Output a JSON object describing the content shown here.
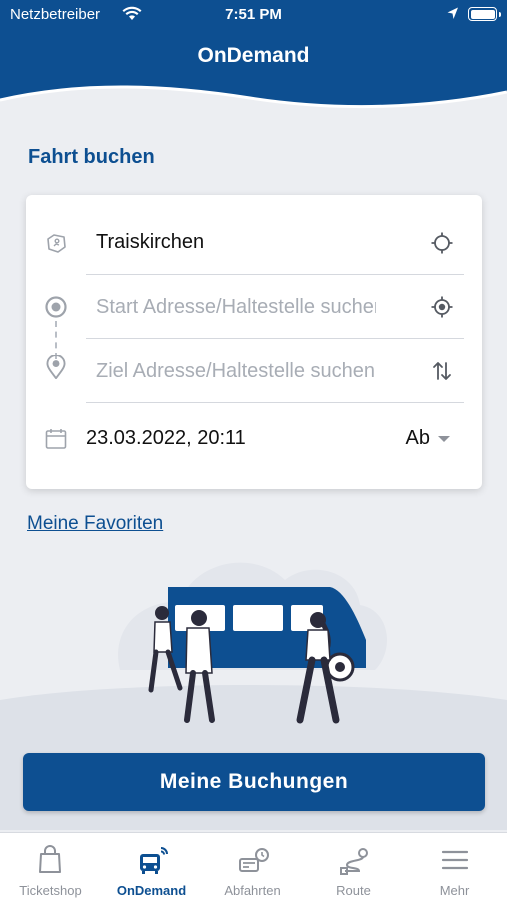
{
  "status_bar": {
    "carrier": "Netzbetreiber",
    "time": "7:51 PM"
  },
  "header": {
    "title": "OnDemand"
  },
  "booking": {
    "heading": "Fahrt buchen",
    "region": "Traiskirchen",
    "start_placeholder": "Start Adresse/Haltestelle suchen",
    "destination_placeholder": "Ziel Adresse/Haltestelle suchen",
    "datetime": "23.03.2022, 20:11",
    "time_mode": "Ab"
  },
  "favorites_link": "Meine Favoriten",
  "bookings_button": "Meine Buchungen",
  "tabs": [
    {
      "label": "Ticketshop",
      "icon": "shopping-bag-icon"
    },
    {
      "label": "OnDemand",
      "icon": "bus-icon",
      "active": true
    },
    {
      "label": "Abfahrten",
      "icon": "departures-icon"
    },
    {
      "label": "Route",
      "icon": "route-icon"
    },
    {
      "label": "Mehr",
      "icon": "menu-icon"
    }
  ],
  "colors": {
    "primary": "#0d4f91",
    "background": "#eceef2",
    "inactive_tab": "#8e929a"
  }
}
